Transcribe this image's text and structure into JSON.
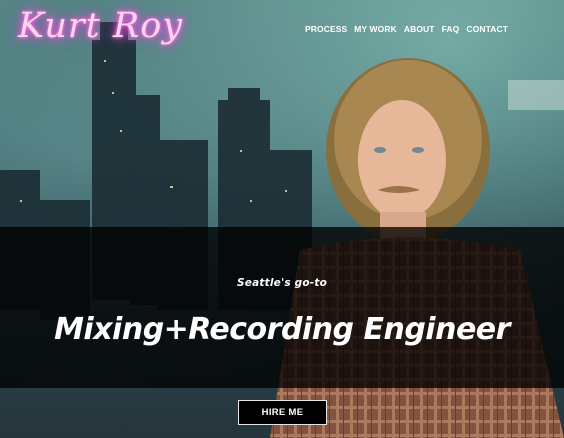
{
  "header": {
    "logo_text": "Kurt Roy"
  },
  "nav": {
    "items": [
      {
        "label": "PROCESS"
      },
      {
        "label": "MY WORK"
      },
      {
        "label": "ABOUT"
      },
      {
        "label": "FAQ"
      },
      {
        "label": "CONTACT"
      }
    ]
  },
  "hero": {
    "tagline": "Seattle's go-to",
    "headline": "Mixing+Recording Engineer",
    "cta_label": "HIRE ME",
    "background_image": "city-skyline-portrait-photo"
  },
  "colors": {
    "logo_neon": "#ff4fd0",
    "band": "#000000",
    "text": "#ffffff"
  }
}
